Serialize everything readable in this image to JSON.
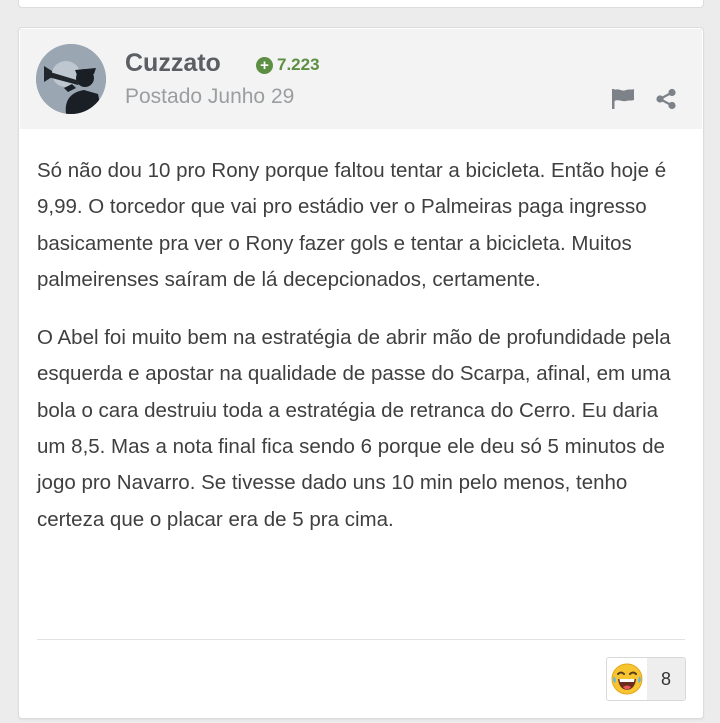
{
  "post": {
    "author": "Cuzzato",
    "reputation": "7.223",
    "posted_label": "Postado Junho 29",
    "paragraphs": [
      "Só não dou 10 pro Rony porque faltou tentar a bicicleta. Então hoje é 9,99. O torcedor que vai pro estádio ver o Palmeiras paga ingresso basicamente pra ver o Rony fazer gols e tentar a bicicleta. Muitos palmeirenses saíram de lá decepcionados, certamente.",
      "O Abel foi muito bem na estratégia de abrir mão de profundidade pela esquerda e apostar na qualidade de passe do Scarpa, afinal, em uma bola o cara destruiu toda a estratégia de retranca do Cerro. Eu daria um 8,5. Mas a nota final fica sendo 6 porque ele deu só 5 minutos de jogo pro Navarro. Se tivesse dado uns 10 min pelo menos, tenho certeza que o placar era de 5 pra cima."
    ],
    "reaction": {
      "icon": "laughing-emoji-icon",
      "count": "8"
    }
  },
  "colors": {
    "reputation": "#5c8f43",
    "header_bg": "#f3f3f3",
    "card_bg": "#ffffff",
    "page_bg": "#ececec",
    "text": "#3f3f3f"
  },
  "icons": {
    "reputation": "plus-circle-icon",
    "report": "flag-icon",
    "share": "share-icon"
  }
}
